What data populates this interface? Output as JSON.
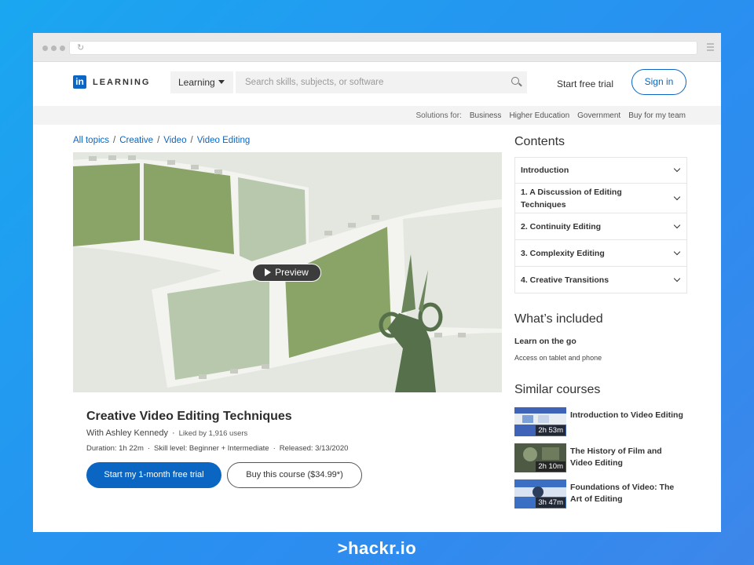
{
  "browser": {
    "reload_icon": "reload-icon"
  },
  "header": {
    "logo_badge": "in",
    "logo_text": "LEARNING",
    "learning_dropdown": "Learning",
    "search_placeholder": "Search skills, subjects, or software",
    "start_free_trial": "Start free trial",
    "sign_in": "Sign in"
  },
  "solutions": {
    "label": "Solutions for:",
    "items": [
      "Business",
      "Higher Education",
      "Government",
      "Buy for my team"
    ]
  },
  "breadcrumb": [
    "All topics",
    "Creative",
    "Video",
    "Video Editing"
  ],
  "hero": {
    "preview_label": "Preview"
  },
  "course": {
    "title": "Creative Video Editing Techniques",
    "author": "With Ashley Kennedy",
    "liked": "Liked by 1,916 users",
    "duration": "Duration: 1h 22m",
    "skill": "Skill level: Beginner + Intermediate",
    "released": "Released: 3/13/2020",
    "primary_button": "Start my 1-month free trial",
    "secondary_button": "Buy this course ($34.99*)"
  },
  "contents": {
    "title": "Contents",
    "items": [
      "Introduction",
      "1. A Discussion of Editing Techniques",
      "2. Continuity Editing",
      "3. Complexity Editing",
      "4. Creative Transitions"
    ]
  },
  "included": {
    "title": "What’s included",
    "item_title": "Learn on the go",
    "item_sub": "Access on tablet and phone"
  },
  "similar": {
    "title": "Similar courses",
    "items": [
      {
        "title": "Introduction to Video Editing",
        "duration": "2h 53m"
      },
      {
        "title": "The History of Film and Video Editing",
        "duration": "2h 10m"
      },
      {
        "title": "Foundations of Video: The Art of Editing",
        "duration": "3h 47m"
      }
    ]
  },
  "footer_brand": ">hackr.io",
  "colors": {
    "brand_blue": "#0a66c2",
    "film_green": "#8aa468",
    "film_pale": "#b8c8ad",
    "background": "#1aa7f0"
  }
}
